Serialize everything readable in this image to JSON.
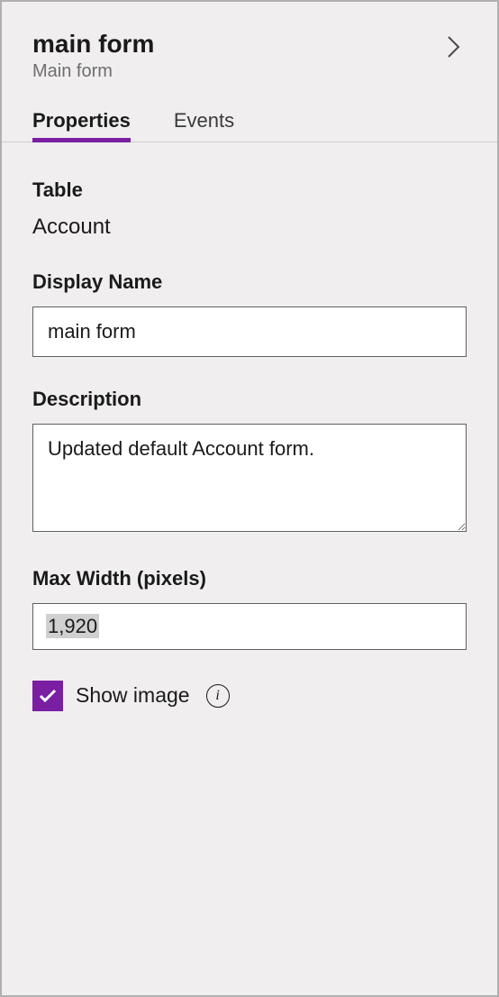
{
  "header": {
    "title": "main form",
    "subtitle": "Main form"
  },
  "tabs": {
    "properties": "Properties",
    "events": "Events"
  },
  "fields": {
    "table": {
      "label": "Table",
      "value": "Account"
    },
    "displayName": {
      "label": "Display Name",
      "value": "main form"
    },
    "description": {
      "label": "Description",
      "value": "Updated default Account form."
    },
    "maxWidth": {
      "label": "Max Width (pixels)",
      "value": "1,920"
    },
    "showImage": {
      "label": "Show image",
      "checked": true
    }
  },
  "colors": {
    "accent": "#7a1fa2"
  }
}
